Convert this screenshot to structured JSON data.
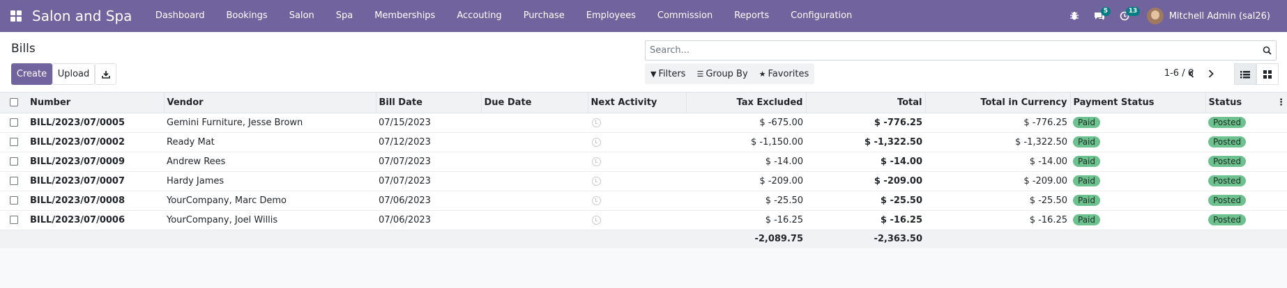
{
  "navbar": {
    "brand": "Salon and Spa",
    "menu": [
      "Dashboard",
      "Bookings",
      "Salon",
      "Spa",
      "Memberships",
      "Accouting",
      "Purchase",
      "Employees",
      "Commission",
      "Reports",
      "Configuration"
    ],
    "messages_badge": "5",
    "activities_badge": "13",
    "user_name": "Mitchell Admin (sal26)",
    "bar_color": "#71639e"
  },
  "control": {
    "title": "Bills",
    "create_label": "Create",
    "upload_label": "Upload",
    "search_placeholder": "Search...",
    "filters_label": "Filters",
    "groupby_label": "Group By",
    "favorites_label": "Favorites",
    "pager": "1-6 / 6"
  },
  "table": {
    "headers": {
      "number": "Number",
      "vendor": "Vendor",
      "bill_date": "Bill Date",
      "due_date": "Due Date",
      "next_activity": "Next Activity",
      "tax_excluded": "Tax Excluded",
      "total": "Total",
      "total_currency": "Total in Currency",
      "payment_status": "Payment Status",
      "status": "Status"
    },
    "rows": [
      {
        "number": "BILL/2023/07/0005",
        "vendor": "Gemini Furniture, Jesse Brown",
        "bill_date": "07/15/2023",
        "due_date": "",
        "tax_excluded": "$ -675.00",
        "total": "$ -776.25",
        "total_currency": "$ -776.25",
        "payment_status": "Paid",
        "status": "Posted"
      },
      {
        "number": "BILL/2023/07/0002",
        "vendor": "Ready Mat",
        "bill_date": "07/12/2023",
        "due_date": "",
        "tax_excluded": "$ -1,150.00",
        "total": "$ -1,322.50",
        "total_currency": "$ -1,322.50",
        "payment_status": "Paid",
        "status": "Posted"
      },
      {
        "number": "BILL/2023/07/0009",
        "vendor": "Andrew Rees",
        "bill_date": "07/07/2023",
        "due_date": "",
        "tax_excluded": "$ -14.00",
        "total": "$ -14.00",
        "total_currency": "$ -14.00",
        "payment_status": "Paid",
        "status": "Posted"
      },
      {
        "number": "BILL/2023/07/0007",
        "vendor": "Hardy James",
        "bill_date": "07/07/2023",
        "due_date": "",
        "tax_excluded": "$ -209.00",
        "total": "$ -209.00",
        "total_currency": "$ -209.00",
        "payment_status": "Paid",
        "status": "Posted"
      },
      {
        "number": "BILL/2023/07/0008",
        "vendor": "YourCompany, Marc Demo",
        "bill_date": "07/06/2023",
        "due_date": "",
        "tax_excluded": "$ -25.50",
        "total": "$ -25.50",
        "total_currency": "$ -25.50",
        "payment_status": "Paid",
        "status": "Posted"
      },
      {
        "number": "BILL/2023/07/0006",
        "vendor": "YourCompany, Joel Willis",
        "bill_date": "07/06/2023",
        "due_date": "",
        "tax_excluded": "$ -16.25",
        "total": "$ -16.25",
        "total_currency": "$ -16.25",
        "payment_status": "Paid",
        "status": "Posted"
      }
    ],
    "footer": {
      "tax_excluded_sum": "-2,089.75",
      "total_sum": "-2,363.50"
    }
  }
}
